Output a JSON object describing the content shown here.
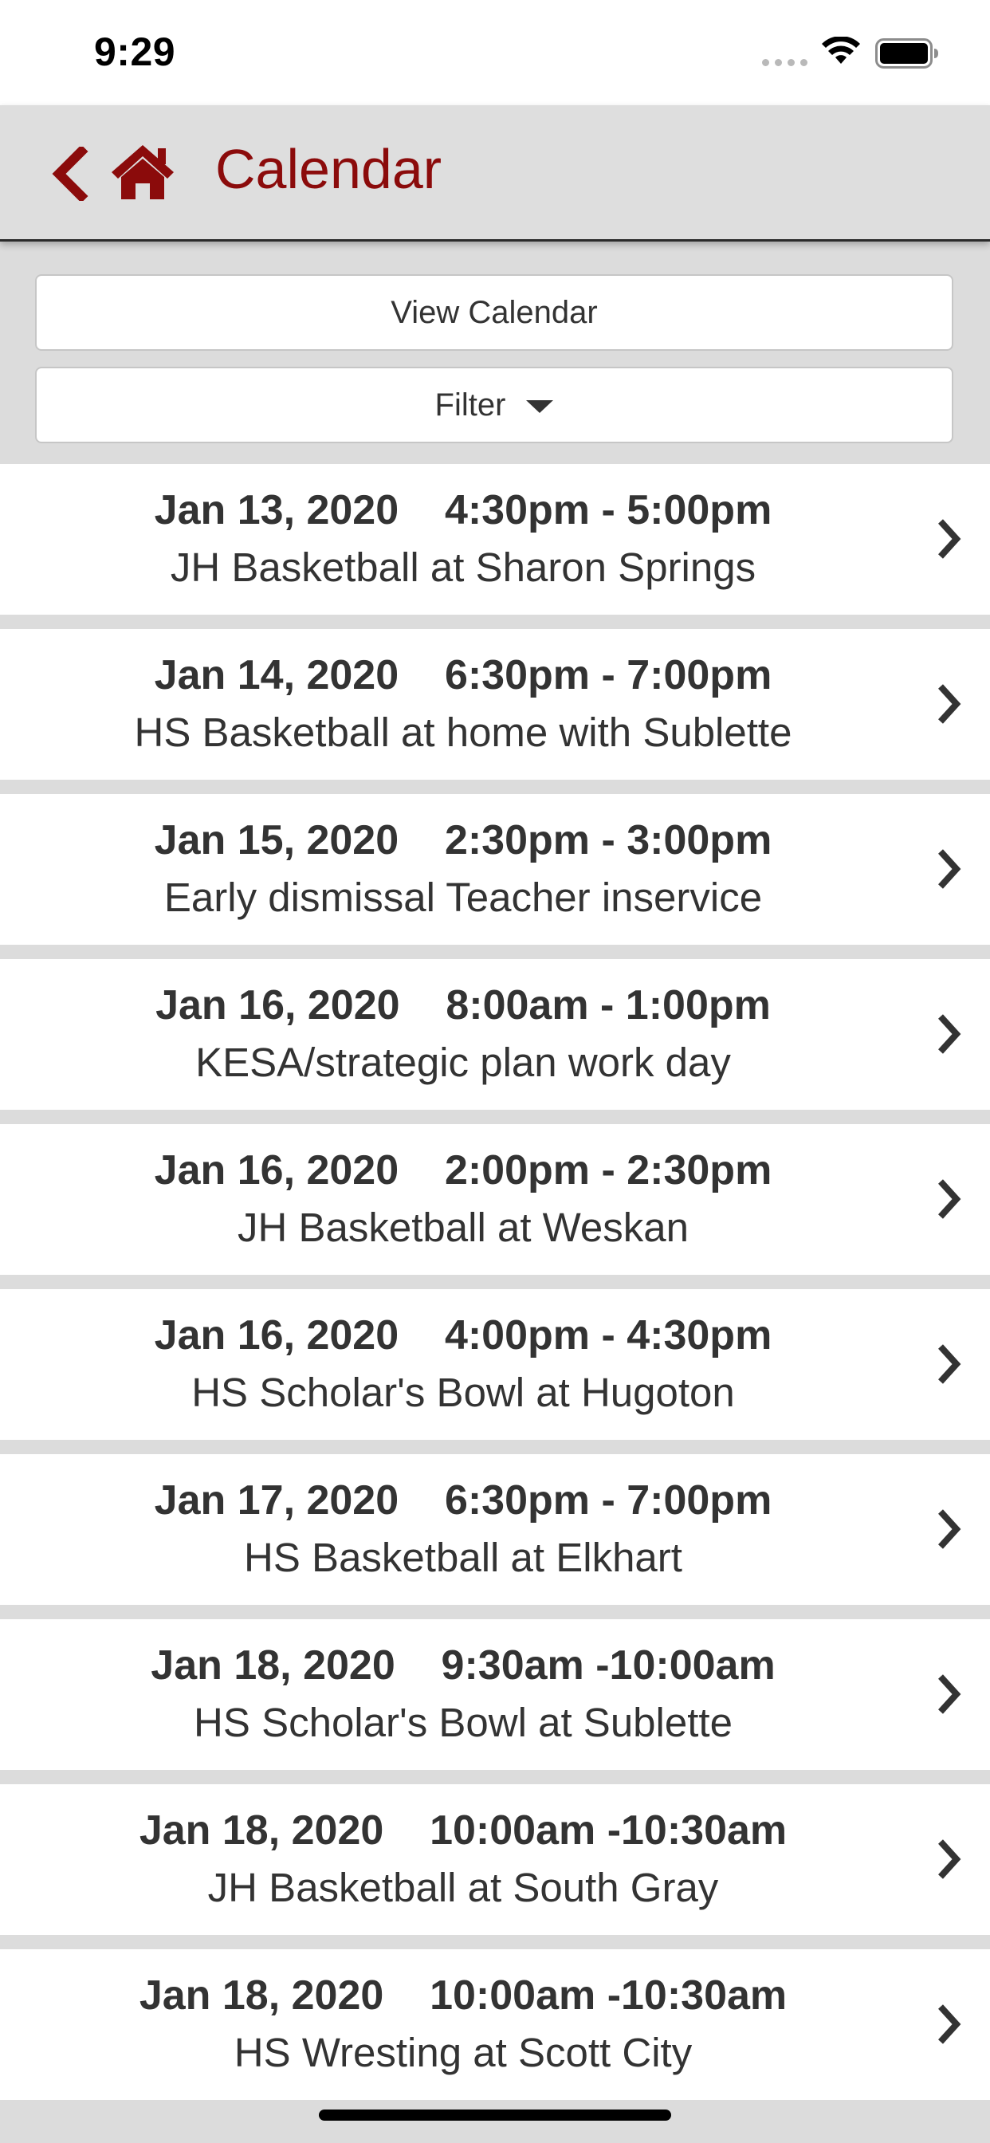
{
  "status_bar": {
    "time": "9:29"
  },
  "header": {
    "title": "Calendar",
    "back_icon": "chevron-left-icon",
    "home_icon": "home-icon",
    "accent_color": "#8b0b0b"
  },
  "actions": {
    "view_calendar_label": "View Calendar",
    "filter_label": "Filter"
  },
  "events": [
    {
      "date": "Jan 13, 2020",
      "time": "4:30pm - 5:00pm",
      "title": "JH Basketball at Sharon Springs"
    },
    {
      "date": "Jan 14, 2020",
      "time": "6:30pm - 7:00pm",
      "title": "HS Basketball at home with Sublette"
    },
    {
      "date": "Jan 15, 2020",
      "time": "2:30pm - 3:00pm",
      "title": "Early dismissal Teacher inservice"
    },
    {
      "date": "Jan 16, 2020",
      "time": "8:00am - 1:00pm",
      "title": "KESA/strategic plan work day"
    },
    {
      "date": "Jan 16, 2020",
      "time": "2:00pm - 2:30pm",
      "title": "JH Basketball at Weskan"
    },
    {
      "date": "Jan 16, 2020",
      "time": "4:00pm - 4:30pm",
      "title": "HS Scholar's Bowl at Hugoton"
    },
    {
      "date": "Jan 17, 2020",
      "time": "6:30pm - 7:00pm",
      "title": "HS Basketball at Elkhart"
    },
    {
      "date": "Jan 18, 2020",
      "time": "9:30am -10:00am",
      "title": "HS Scholar's Bowl at Sublette"
    },
    {
      "date": "Jan 18, 2020",
      "time": "10:00am -10:30am",
      "title": "JH Basketball at South Gray"
    },
    {
      "date": "Jan 18, 2020",
      "time": "10:00am -10:30am",
      "title": "HS Wresting at Scott City"
    }
  ]
}
